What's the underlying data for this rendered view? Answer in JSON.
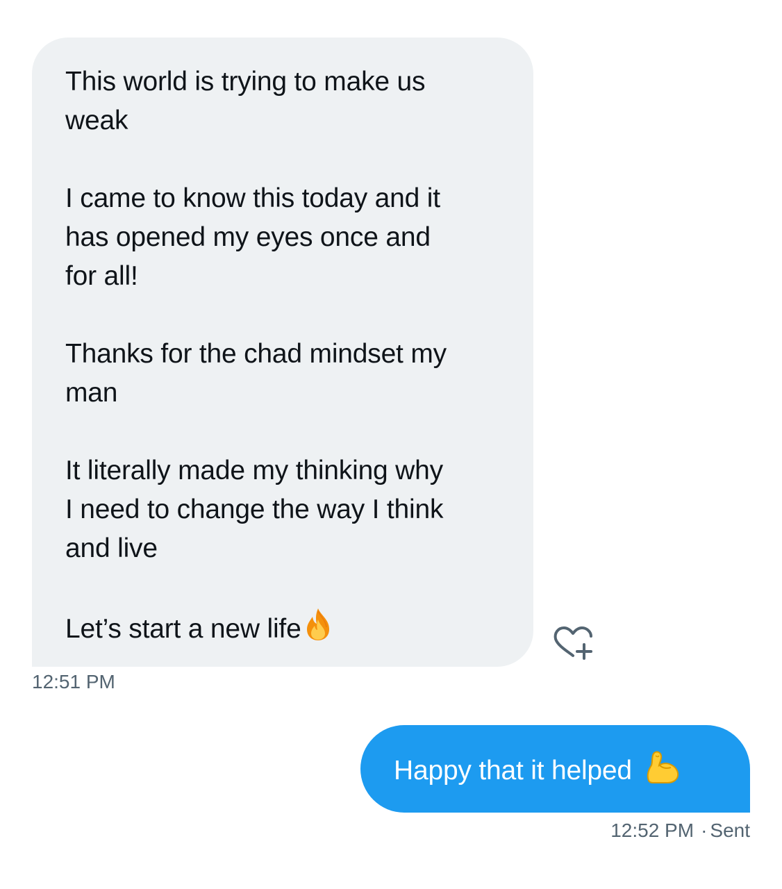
{
  "received_message": {
    "paragraphs": [
      [
        "This world is trying to make us",
        "weak"
      ],
      [
        "I came to know this today and it",
        "has opened my eyes once and",
        "for all!"
      ],
      [
        "Thanks for the chad mindset my",
        "man"
      ],
      [
        "It literally made my thinking why",
        "I need to change the way I think",
        "and live"
      ]
    ],
    "last_line": "Let’s start a new life",
    "last_line_emoji": "fire-emoji",
    "time": "12:51 PM"
  },
  "react_icon": "heart-plus-icon",
  "sent_message": {
    "text": "Happy that it helped",
    "emoji": "flexed-biceps-emoji",
    "time": "12:52 PM",
    "separator": "·",
    "status": "Sent"
  },
  "colors": {
    "received_bubble": "#eef1f3",
    "sent_bubble": "#1d9bf0",
    "meta_text": "#536471"
  }
}
